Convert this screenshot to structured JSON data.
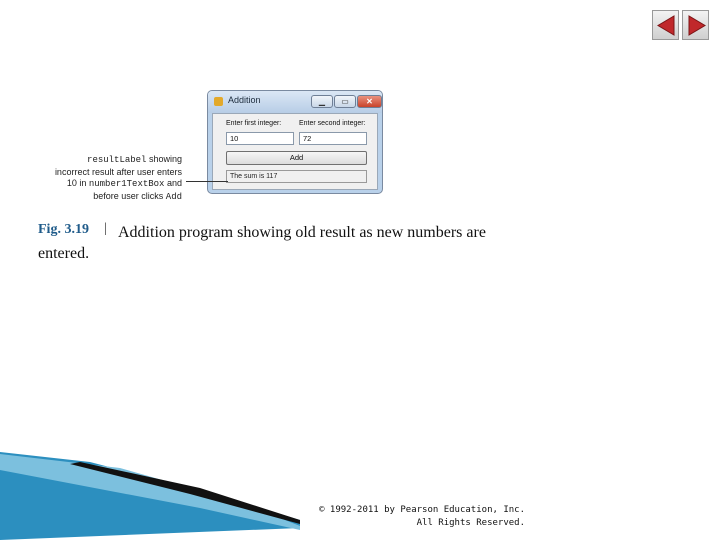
{
  "window": {
    "title": "Addition",
    "first_label": "Enter first integer:",
    "second_label": "Enter second integer:",
    "first_value": "10",
    "second_value": "72",
    "add_button": "Add",
    "result_text": "The sum is 117"
  },
  "callout": {
    "result_label": "resultLabel",
    "line1_rest": " showing",
    "line2": "incorrect result after user enters",
    "line3_pre": "10 in ",
    "number1_textbox": "number1TextBox",
    "line3_post": " and",
    "line4_pre": "before user clicks ",
    "add_word": "Add"
  },
  "figure": {
    "label": "Fig. 3.19",
    "separator": "|",
    "caption": "Addition program showing old result as new numbers are entered."
  },
  "footer": {
    "copyright_line1": "© 1992-2011 by Pearson Education, Inc.",
    "copyright_line2": "All Rights Reserved."
  },
  "icons": {
    "prev": "previous-slide-icon",
    "next": "next-slide-icon",
    "close": "close-icon",
    "minimize": "minimize-icon",
    "maximize": "maximize-icon"
  },
  "colors": {
    "nav_arrow": "#c0282b",
    "figure_label": "#1f5b8a",
    "swoosh_blue": "#2c8fbf"
  }
}
